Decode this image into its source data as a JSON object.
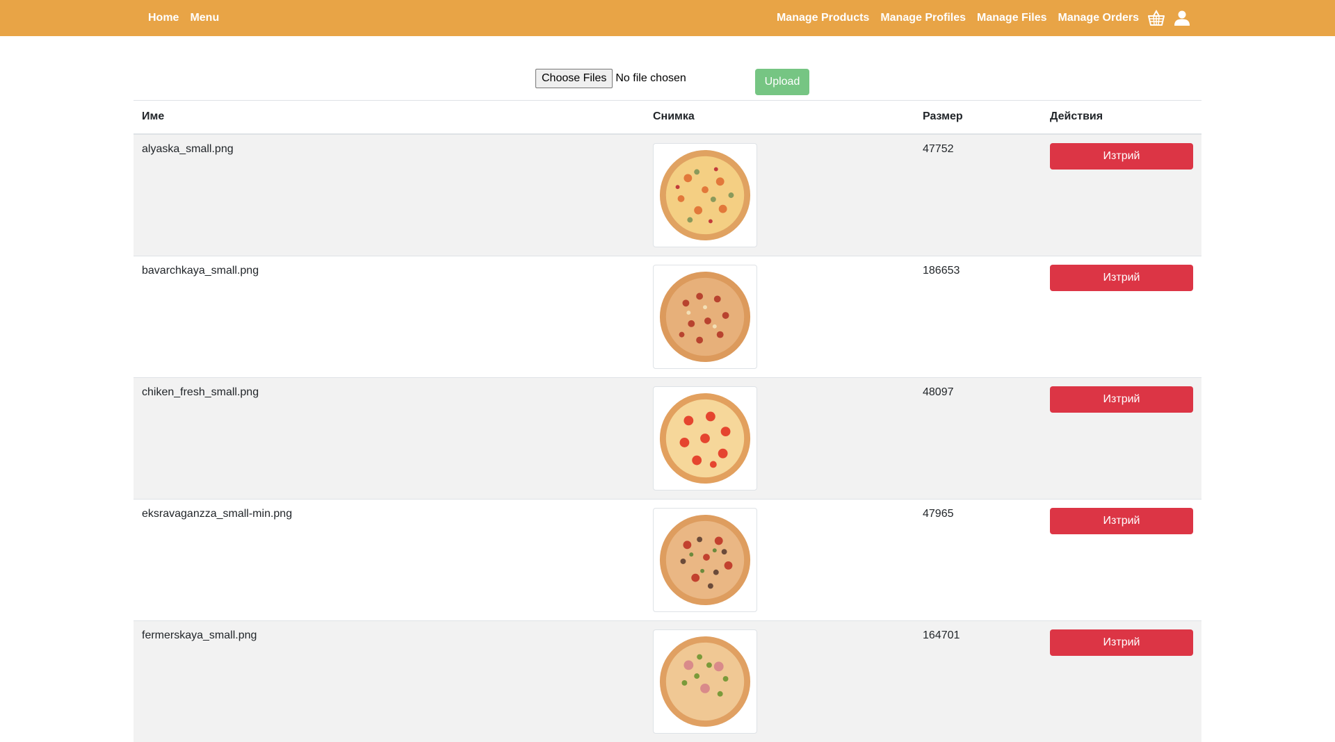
{
  "nav": {
    "home": "Home",
    "menu": "Menu",
    "manage_products": "Manage Products",
    "manage_profiles": "Manage Profiles",
    "manage_files": "Manage Files",
    "manage_orders": "Manage Orders",
    "basket_icon": "basket-icon",
    "user_icon": "user-icon"
  },
  "upload": {
    "choose_label": "Choose Files",
    "status": "No file chosen",
    "button_label": "Upload"
  },
  "table": {
    "headers": {
      "name": "Име",
      "image": "Снимка",
      "size": "Размер",
      "actions": "Действия"
    },
    "rows": [
      {
        "name": "alyaska_small.png",
        "size": "47752",
        "delete_label": "Изтрий"
      },
      {
        "name": "bavarchkaya_small.png",
        "size": "186653",
        "delete_label": "Изтрий"
      },
      {
        "name": "chiken_fresh_small.png",
        "size": "48097",
        "delete_label": "Изтрий"
      },
      {
        "name": "eksravaganzza_small-min.png",
        "size": "47965",
        "delete_label": "Изтрий"
      },
      {
        "name": "fermerskaya_small.png",
        "size": "164701",
        "delete_label": "Изтрий"
      }
    ]
  },
  "colors": {
    "navbar": "#e8a446",
    "upload_button": "#76c583",
    "delete_button": "#dc3545",
    "row_stripe": "#f2f2f2"
  }
}
